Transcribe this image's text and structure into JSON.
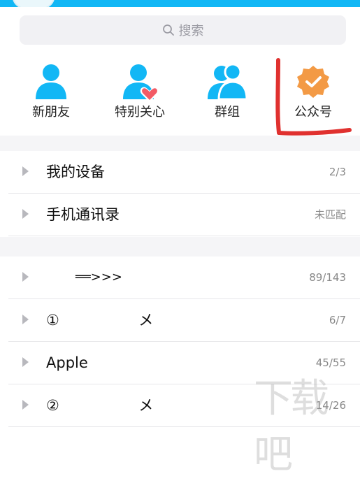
{
  "search": {
    "placeholder": "搜索"
  },
  "quick": [
    {
      "label": "新朋友"
    },
    {
      "label": "特别关心"
    },
    {
      "label": "群组"
    },
    {
      "label": "公众号"
    }
  ],
  "groups": [
    {
      "name": "我的设备",
      "count": "2/3"
    },
    {
      "name": "手机通讯录",
      "count": "未匹配"
    },
    {
      "name": "══>>>",
      "count": "89/143"
    },
    {
      "name": "①                 メ",
      "count": "6/7"
    },
    {
      "name": "Apple",
      "count": "45/55"
    },
    {
      "name": "②                 メ",
      "count": "14/26"
    }
  ],
  "colors": {
    "accent": "#12b7f5",
    "annotation": "#e0312f",
    "badge": "#f39a45",
    "heart": "#f25b66"
  }
}
